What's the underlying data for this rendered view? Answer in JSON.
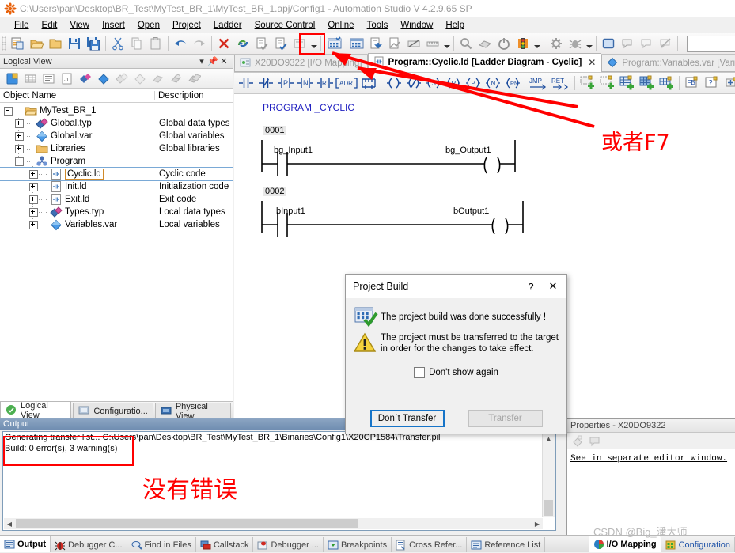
{
  "window": {
    "title": "C:\\Users\\pan\\Desktop\\BR_Test\\MyTest_BR_1\\MyTest_BR_1.apj/Config1 - Automation Studio V 4.2.9.65 SP",
    "app_icon": "br-logo-icon"
  },
  "menubar": {
    "items": [
      {
        "label": "File"
      },
      {
        "label": "Edit"
      },
      {
        "label": "View"
      },
      {
        "label": "Insert"
      },
      {
        "label": "Open"
      },
      {
        "label": "Project"
      },
      {
        "label": "Ladder"
      },
      {
        "label": "Source Control"
      },
      {
        "label": "Online"
      },
      {
        "label": "Tools"
      },
      {
        "label": "Window"
      },
      {
        "label": "Help"
      }
    ]
  },
  "toolbar": {
    "combo_value": "",
    "buttons": [
      {
        "name": "new-project-icon"
      },
      {
        "name": "open-project-icon"
      },
      {
        "name": "open-folder-icon"
      },
      {
        "name": "save-icon"
      },
      {
        "name": "save-all-icon"
      },
      {
        "name": "cut-icon"
      },
      {
        "name": "copy-icon"
      },
      {
        "name": "paste-icon"
      },
      {
        "name": "undo-icon"
      },
      {
        "name": "redo-icon"
      },
      {
        "name": "delete-icon"
      },
      {
        "name": "refresh-icon"
      },
      {
        "name": "check-file-icon"
      },
      {
        "name": "check-config-icon"
      },
      {
        "name": "properties-icon"
      },
      {
        "name": "build-project-icon"
      },
      {
        "name": "rebuild-project-icon"
      },
      {
        "name": "transfer-icon"
      },
      {
        "name": "create-install-icon"
      },
      {
        "name": "simulation-icon"
      },
      {
        "name": "measure-icon"
      },
      {
        "name": "find-icon"
      },
      {
        "name": "online-connect-icon"
      },
      {
        "name": "power-icon"
      },
      {
        "name": "traffic-light-icon"
      },
      {
        "name": "debug-settings-icon"
      },
      {
        "name": "debug-bug-icon"
      },
      {
        "name": "watch-window-icon"
      },
      {
        "name": "output-window-icon"
      },
      {
        "name": "message-window-icon"
      },
      {
        "name": "cancel-watch-icon"
      }
    ]
  },
  "logical_view": {
    "caption": "Logical View",
    "caption_buttons": [
      "chevron-down-icon",
      "pin-icon",
      "close-icon"
    ],
    "columns": {
      "name": "Object Name",
      "description": "Description"
    },
    "tree": [
      {
        "level": 0,
        "label": "MyTest_BR_1",
        "desc": "",
        "icon": "project-folder-icon",
        "expander": "minus"
      },
      {
        "level": 1,
        "label": "Global.typ",
        "desc": "Global data types",
        "icon": "datatype-icon",
        "expander": "plus"
      },
      {
        "level": 1,
        "label": "Global.var",
        "desc": "Global variables",
        "icon": "variable-icon",
        "expander": "plus"
      },
      {
        "level": 1,
        "label": "Libraries",
        "desc": "Global libraries",
        "icon": "folder-icon",
        "expander": "plus"
      },
      {
        "level": 1,
        "label": "Program",
        "desc": "",
        "icon": "program-icon",
        "expander": "minus"
      },
      {
        "level": 2,
        "label": "Cyclic.ld",
        "desc": "Cyclic code",
        "icon": "ladder-file-icon",
        "expander": "plus",
        "selected": true
      },
      {
        "level": 2,
        "label": "Init.ld",
        "desc": "Initialization code",
        "icon": "ladder-file-icon",
        "expander": "plus"
      },
      {
        "level": 2,
        "label": "Exit.ld",
        "desc": "Exit code",
        "icon": "ladder-file-icon",
        "expander": "plus"
      },
      {
        "level": 2,
        "label": "Types.typ",
        "desc": "Local data types",
        "icon": "datatype-icon",
        "expander": "plus"
      },
      {
        "level": 2,
        "label": "Variables.var",
        "desc": "Local variables",
        "icon": "variable-icon",
        "expander": "plus"
      }
    ],
    "tabs": [
      {
        "label": "Logical View",
        "icon": "logical-view-icon",
        "active": true
      },
      {
        "label": "Configuratio...",
        "icon": "configuration-view-icon",
        "active": false
      },
      {
        "label": "Physical View",
        "icon": "physical-view-icon",
        "active": false
      }
    ]
  },
  "editor": {
    "tabs": [
      {
        "label": "X20DO9322 [I/O Mapping]",
        "icon": "io-mapping-icon",
        "active": false,
        "closable": false
      },
      {
        "label": "Program::Cyclic.ld [Ladder Diagram - Cyclic]",
        "icon": "ladder-file-icon",
        "active": true,
        "closable": true,
        "close_glyph": "✕"
      },
      {
        "label": "Program::Variables.var [Variable",
        "icon": "variable-icon",
        "active": false,
        "closable": false
      }
    ],
    "ladder_toolbar": [
      {
        "name": "contact-no-icon",
        "glyph": "┤ ├"
      },
      {
        "name": "contact-nc-icon",
        "glyph": "┤/├"
      },
      {
        "name": "contact-positive-icon",
        "glyph": "P"
      },
      {
        "name": "contact-negative-icon",
        "glyph": "N"
      },
      {
        "name": "contact-rising-icon",
        "glyph": "R"
      },
      {
        "name": "address-icon",
        "glyph": "ADR"
      },
      {
        "name": "branch-icon",
        "glyph": "┐┌"
      },
      {
        "name": "coil-icon",
        "glyph": "( )"
      },
      {
        "name": "coil-negated-icon",
        "glyph": "(/)"
      },
      {
        "name": "coil-set-icon",
        "glyph": "(S)"
      },
      {
        "name": "coil-reset-icon",
        "glyph": "(R)"
      },
      {
        "name": "coil-p-icon",
        "glyph": "(P)"
      },
      {
        "name": "coil-n-icon",
        "glyph": "(N)"
      },
      {
        "name": "coil-rn-icon",
        "glyph": "(RN)"
      },
      {
        "name": "jump-icon",
        "glyph": "JMP"
      },
      {
        "name": "return-icon",
        "glyph": "RET"
      },
      {
        "name": "insert-rung-above-icon",
        "glyph": ""
      },
      {
        "name": "insert-rung-below-icon",
        "glyph": ""
      },
      {
        "name": "insert-column-icon",
        "glyph": ""
      },
      {
        "name": "insert-row-icon",
        "glyph": ""
      },
      {
        "name": "append-row-icon",
        "glyph": ""
      },
      {
        "name": "function-block-icon",
        "glyph": "FB"
      },
      {
        "name": "help-element-icon",
        "glyph": "?"
      },
      {
        "name": "add-input-icon",
        "glyph": ""
      },
      {
        "name": "goto-icon",
        "glyph": ""
      },
      {
        "name": "compare-icon",
        "glyph": "≠"
      },
      {
        "name": "calculator-icon",
        "glyph": ""
      }
    ],
    "program_title": "PROGRAM _CYCLIC",
    "rungs": [
      {
        "number": "0001",
        "input": "bg_Input1",
        "output": "bg_Output1"
      },
      {
        "number": "0002",
        "input": "bInput1",
        "output": "bOutput1"
      }
    ]
  },
  "dialog": {
    "title": "Project Build",
    "help_glyph": "?",
    "close_glyph": "✕",
    "success_icon": "build-success-icon",
    "success_message": "The project build was done successfully !",
    "warning_icon": "warning-triangle-icon",
    "warning_message_line1": "The project must be transferred to the target",
    "warning_message_line2": "in order for the changes to take effect.",
    "checkbox_label": "Don't show again",
    "checkbox_checked": false,
    "buttons": [
      {
        "label": "Don´t Transfer",
        "default": true,
        "disabled": false
      },
      {
        "label": "Transfer",
        "default": false,
        "disabled": true
      }
    ]
  },
  "output_panel": {
    "caption": "Output",
    "lines": [
      "Generating transfer list... C:\\Users\\pan\\Desktop\\BR_Test\\MyTest_BR_1\\Binaries\\Config1\\X20CP1584\\Transfer.pil",
      "Build: 0 error(s), 3 warning(s)"
    ]
  },
  "properties_panel": {
    "caption": "Properties - X20DO9322",
    "toolbar_icons": [
      "properties-sort-icon",
      "comment-icon"
    ],
    "body_text": "See in separate editor window."
  },
  "bottom_tabs": [
    {
      "label": "Output",
      "icon": "output-icon",
      "active": true
    },
    {
      "label": "Debugger C...",
      "icon": "debugger-console-icon",
      "active": false
    },
    {
      "label": "Find in Files",
      "icon": "find-in-files-icon",
      "active": false
    },
    {
      "label": "Callstack",
      "icon": "callstack-icon",
      "active": false
    },
    {
      "label": "Debugger ...",
      "icon": "debugger-icon",
      "active": false
    },
    {
      "label": "Breakpoints",
      "icon": "breakpoints-icon",
      "active": false
    },
    {
      "label": "Cross Refer...",
      "icon": "cross-reference-icon",
      "active": false
    },
    {
      "label": "Reference List",
      "icon": "reference-list-icon",
      "active": false
    }
  ],
  "bottom_tabs_right": [
    {
      "label": "I/O Mapping",
      "icon": "io-mapping-icon",
      "active": true
    },
    {
      "label": "Configuration",
      "icon": "configuration-icon",
      "active": false
    }
  ],
  "annotations": {
    "build_button_label": "或者F7",
    "no_errors_label": "没有错误",
    "watermark": "CSDN @Big_潘大师",
    "accent_color": "#ff0000"
  }
}
